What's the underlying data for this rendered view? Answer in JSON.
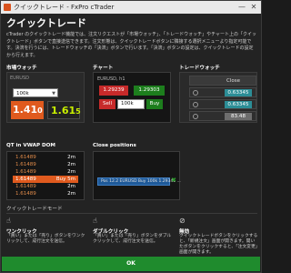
{
  "window": {
    "title": "クイックトレード - FxPro cTrader"
  },
  "page": {
    "title": "クイックトレード",
    "description": "cTrader のクイックトレード機能では、注文リクエストが「市場ウォッチ」、「トレードウォッチ」やチャート上の「クイックトレード」ボタンで直接送信できます。注文形態は、クイックトレードボタンに隣接する選択メニューより指定可能です。決済を行うには、トレードウォッチの「決済」ボタンで行います。「決済」ボタンの設定は、クイックトレードの設定から行えます。"
  },
  "sections": {
    "market_watch": {
      "label": "市場ウォッチ",
      "symbol_name": "EURUSD",
      "volume": "100k",
      "sell_price": "1.41",
      "sell_pips": "0",
      "buy_price": "1.61",
      "buy_pips": "5"
    },
    "chart": {
      "label": "チャート",
      "pair": "EURUSD, h1",
      "bid": "1.29239",
      "ask": "1.29303",
      "sell_label": "Sell",
      "volume": "100k",
      "buy_label": "Buy"
    },
    "trade_watch": {
      "label": "トレードウォッチ",
      "header": "Close",
      "rows": [
        {
          "value": "0.63345",
          "style": "teal"
        },
        {
          "value": "0.63345",
          "style": "teal"
        },
        {
          "value": "83.48",
          "style": "gray"
        }
      ]
    },
    "dom": {
      "label": "QT in VWAP DOM",
      "rows": [
        {
          "price": "1.61489",
          "qty": "2m",
          "highlight": false
        },
        {
          "price": "1.61489",
          "qty": "2m",
          "highlight": false
        },
        {
          "price": "1.61489",
          "qty": "2m",
          "highlight": false
        },
        {
          "price": "1.61489",
          "qty": "Buy  5m",
          "highlight": true
        },
        {
          "price": "1.61489",
          "qty": "2m",
          "highlight": false
        },
        {
          "price": "1.61489",
          "qty": "2m",
          "highlight": false
        }
      ]
    },
    "close_positions": {
      "label": "Close positions",
      "row_text": "Pos  12.2  EURUSD  Buy  100k  1.29341  ..."
    }
  },
  "modes": {
    "label": "クイックトレードモード",
    "items": [
      {
        "icon": "single-click-icon",
        "title": "ワンクリック",
        "description": "「買い」または「売り」ボタンをワンクリックして、成行注文を送信。"
      },
      {
        "icon": "double-click-icon",
        "title": "ダブルクリック",
        "description": "「買い」または「売り」ボタンをダブルクリックして、成行注文を送信。"
      },
      {
        "icon": "disabled-icon",
        "title": "無効",
        "description": "クイックトレードボタンをクリックすると、「新規注文」画面が開きます。開いたボタンをクリックすると、「注文変更」画面が開きます。"
      }
    ]
  },
  "footer": {
    "ok_label": "OK"
  },
  "colors": {
    "accent": "#e05a1e",
    "ok": "#1f8b2d",
    "buy": "#c9ef00",
    "teal": "#2c8d96"
  }
}
